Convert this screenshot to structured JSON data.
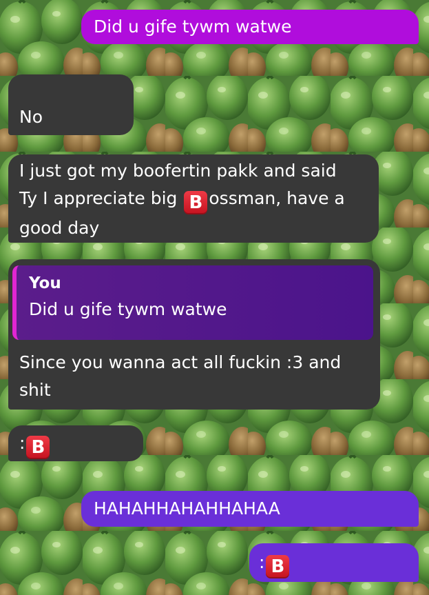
{
  "messages": [
    {
      "id": "m1",
      "text": "Did u gife tywm watwe"
    },
    {
      "id": "m2",
      "text": "No"
    },
    {
      "id": "m3",
      "line1": "I just got my boofertin pakk and said",
      "line2_pre": "Ty I appreciate big",
      "emoji": "B",
      "line2_post": "ossman, have a",
      "line3": "good day"
    },
    {
      "id": "m4",
      "quote_author": "You",
      "quote_text": "Did u gife tywm watwe",
      "line1": "Since you wanna act all fuckin :3 and",
      "line2": "shit"
    },
    {
      "id": "m5",
      "prefix": ":",
      "emoji": "B"
    },
    {
      "id": "m6",
      "text": "HAHAHHAHAHHAHAA"
    },
    {
      "id": "m7",
      "prefix": ":",
      "emoji": "B"
    }
  ],
  "colors": {
    "sent_magenta": "#b00ddc",
    "sent_purple": "#6a2fd8",
    "received": "#383838",
    "quote_bar": "#e026d2",
    "background": "#4f7d3a"
  },
  "icons": {
    "emoji": "b-button-emoji"
  }
}
